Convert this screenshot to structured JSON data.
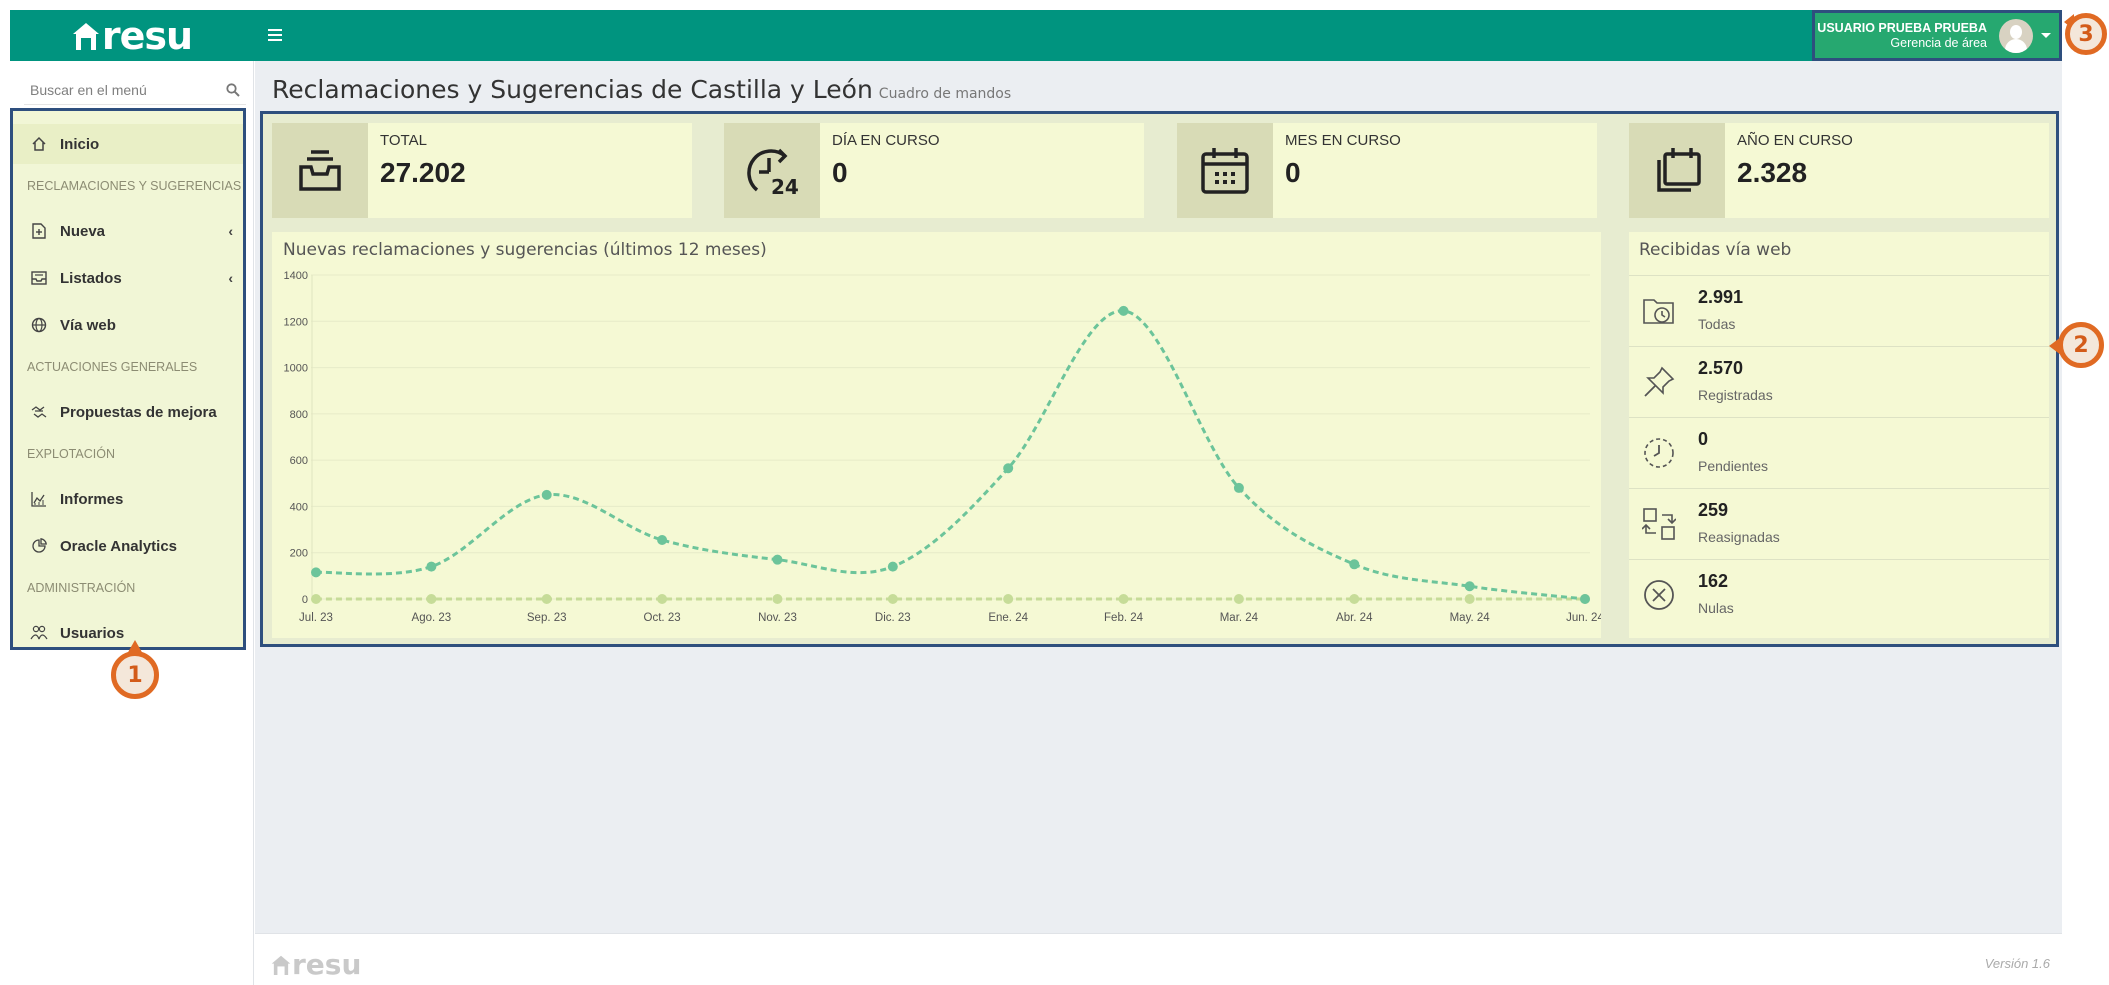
{
  "brand": {
    "logo_text": "resu"
  },
  "header": {
    "user_name": "USUARIO PRUEBA PRUEBA",
    "user_role": "Gerencia de área"
  },
  "sidebar": {
    "search_placeholder": "Buscar en el menú",
    "items": [
      {
        "label": "Inicio",
        "icon": "home-icon"
      },
      {
        "label": "Nueva",
        "icon": "new-file-icon"
      },
      {
        "label": "Listados",
        "icon": "inbox-icon"
      },
      {
        "label": "Vía web",
        "icon": "globe-icon"
      },
      {
        "label": "Propuestas de mejora",
        "icon": "handshake-icon"
      },
      {
        "label": "Informes",
        "icon": "chart-icon"
      },
      {
        "label": "Oracle Analytics",
        "icon": "pie-chart-icon"
      },
      {
        "label": "Usuarios",
        "icon": "users-icon"
      }
    ],
    "sections": [
      "RECLAMACIONES Y SUGERENCIAS",
      "ACTUACIONES GENERALES",
      "EXPLOTACIÓN",
      "ADMINISTRACIÓN"
    ]
  },
  "page": {
    "title": "Reclamaciones y Sugerencias de Castilla y León",
    "subtitle": "Cuadro de mandos"
  },
  "stats": [
    {
      "label": "TOTAL",
      "value": "27.202",
      "icon": "inbox-tray-icon"
    },
    {
      "label": "DÍA EN CURSO",
      "value": "0",
      "icon": "clock-24-icon"
    },
    {
      "label": "MES EN CURSO",
      "value": "0",
      "icon": "calendar-icon"
    },
    {
      "label": "AÑO EN CURSO",
      "value": "2.328",
      "icon": "calendar-stack-icon"
    }
  ],
  "chart_card": {
    "title": "Nuevas reclamaciones y sugerencias (últimos 12 meses)"
  },
  "chart_data": {
    "type": "line",
    "title": "Nuevas reclamaciones y sugerencias (últimos 12 meses)",
    "categories": [
      "Jul. 23",
      "Ago. 23",
      "Sep. 23",
      "Oct. 23",
      "Nov. 23",
      "Dic. 23",
      "Ene. 24",
      "Feb. 24",
      "Mar. 24",
      "Abr. 24",
      "May. 24",
      "Jun. 24"
    ],
    "series": [
      {
        "values": [
          115,
          140,
          450,
          255,
          170,
          140,
          565,
          1245,
          480,
          150,
          55,
          0
        ],
        "color": "#6cc49a"
      },
      {
        "values": [
          0,
          0,
          0,
          0,
          0,
          0,
          0,
          0,
          0,
          0,
          0,
          0
        ],
        "color": "#c6dc98"
      }
    ],
    "yticks": [
      "0",
      "200",
      "400",
      "600",
      "800",
      "1000",
      "1200",
      "1400"
    ],
    "ylim": [
      0,
      1400
    ],
    "smooth": true,
    "dashed": true
  },
  "web_card": {
    "title": "Recibidas vía web",
    "rows": [
      {
        "value": "2.991",
        "label": "Todas",
        "icon": "folder-clock-icon"
      },
      {
        "value": "2.570",
        "label": "Registradas",
        "icon": "pin-icon"
      },
      {
        "value": "0",
        "label": "Pendientes",
        "icon": "clock-dashed-icon"
      },
      {
        "value": "259",
        "label": "Reasignadas",
        "icon": "reassign-icon"
      },
      {
        "value": "162",
        "label": "Nulas",
        "icon": "cancel-circle-icon"
      }
    ]
  },
  "callouts": [
    "1",
    "2",
    "3"
  ],
  "footer": {
    "logo_text": "resu",
    "version": "Versión 1.6"
  }
}
